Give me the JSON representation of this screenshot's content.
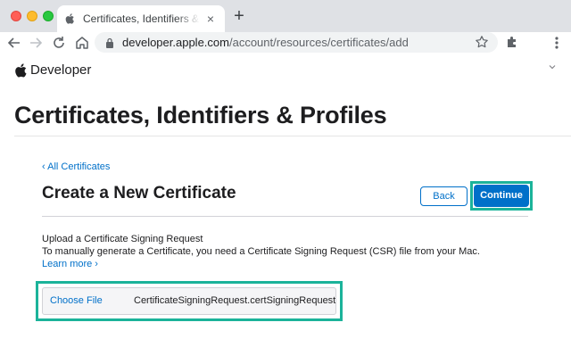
{
  "browser": {
    "tab_title": "Certificates, Identifiers & Profiles",
    "tab_close": "×",
    "new_tab": "+",
    "url_host": "developer.apple.com",
    "url_path": "/account/resources/certificates/add",
    "icons": [
      "apple-icon",
      "close-icon",
      "plus-icon",
      "back-arrow-icon",
      "forward-arrow-icon",
      "reload-icon",
      "home-icon",
      "lock-icon",
      "star-icon",
      "puzzle-icon",
      "more-menu-icon"
    ]
  },
  "site": {
    "brand": "Developer",
    "page_title": "Certificates, Identifiers & Profiles"
  },
  "main": {
    "breadcrumb": "‹ All Certificates",
    "section_title": "Create a New Certificate",
    "back_label": "Back",
    "continue_label": "Continue",
    "upload_title": "Upload a Certificate Signing Request",
    "upload_desc": "To manually generate a Certificate, you need a Certificate Signing Request (CSR) file from your Mac.",
    "learn_more": "Learn more ›",
    "choose_file_label": "Choose File",
    "file_name": "CertificateSigningRequest.certSigningRequest"
  },
  "colors": {
    "link": "#0070c9",
    "primary_button": "#0070c9",
    "highlight": "#1bb39a",
    "text": "#1d1d1f"
  }
}
